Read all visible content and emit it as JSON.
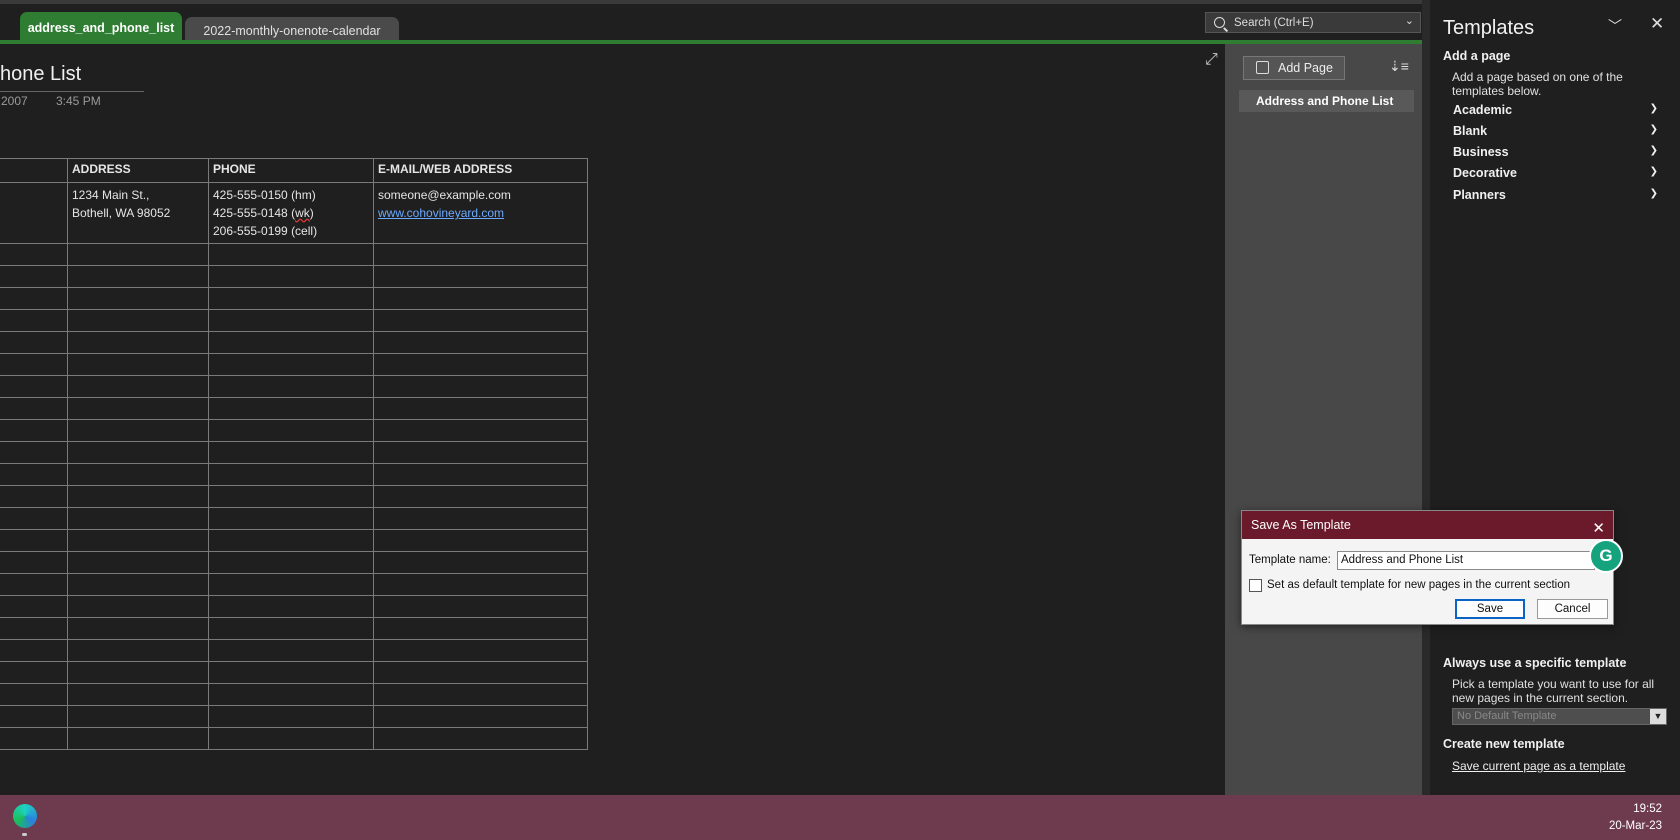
{
  "tabs": [
    {
      "label": "address_and_phone_list",
      "active": true
    },
    {
      "label": "2022-monthly-onenote-calendar",
      "active": false
    }
  ],
  "search": {
    "placeholder": "Search (Ctrl+E)"
  },
  "page": {
    "title": "hone List",
    "date": "2007",
    "time": "3:45 PM"
  },
  "table": {
    "headers": [
      "",
      "ADDRESS",
      "PHONE",
      "E-MAIL/WEB ADDRESS"
    ],
    "first_row": {
      "address_line1": "1234 Main St.,",
      "address_line2": "Bothell, WA 98052",
      "phone1": "425-555-0150 (hm)",
      "phone2_pre": "425-555-0148 (",
      "phone2_squig": "wk",
      "phone2_post": ")",
      "phone3": "206-555-0199 (cell)",
      "email": "someone@example.com",
      "web": "www.cohovineyard.com"
    },
    "empty_rows": 23
  },
  "pages_pane": {
    "add_page_label": "Add Page",
    "pages": [
      "Address and Phone List"
    ]
  },
  "templates": {
    "title": "Templates",
    "add_page_heading": "Add a page",
    "add_page_desc": "Add a page based on one of the templates below.",
    "categories": [
      "Academic",
      "Blank",
      "Business",
      "Decorative",
      "Planners"
    ],
    "always_heading": "Always use a specific template",
    "always_desc": "Pick a template you want to use for all new pages in the current section.",
    "select_value": "No Default Template",
    "create_heading": "Create new template",
    "create_link": "Save current page as a template"
  },
  "dialog": {
    "title": "Save As Template",
    "name_label": "Template name:",
    "name_value": "Address and Phone List",
    "checkbox_label": "Set as default template for new pages in the current section",
    "save_label": "Save",
    "cancel_label": "Cancel"
  },
  "taskbar": {
    "time": "19:52",
    "date": "20-Mar-23"
  },
  "colors": {
    "tab_active": "#2e7d32",
    "dialog_title": "#6b1a2b",
    "taskbar": "#6e3a4d",
    "link": "#6aa9ff"
  }
}
